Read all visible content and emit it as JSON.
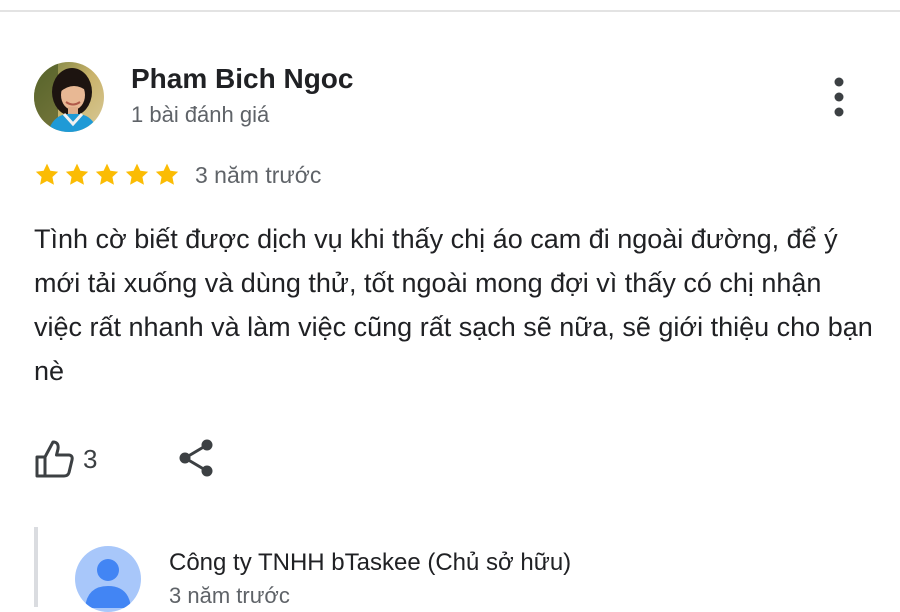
{
  "review": {
    "author": {
      "name": "Pham Bich Ngoc",
      "meta": "1 bài đánh giá"
    },
    "rating": {
      "value": 5,
      "max": 5,
      "star_color": "#fbbc04"
    },
    "time": "3 năm trước",
    "text": "Tình cờ biết được dịch vụ khi thấy chị áo cam đi ngoài đường, để ý mới tải xuống và dùng thử, tốt ngoài mong đợi vì thấy có chị nhận việc rất nhanh và làm việc cũng rất sạch sẽ nữa, sẽ giới thiệu cho bạn nè",
    "likes": "3",
    "icons": {
      "more": "more-vertical-icon",
      "like": "thumbs-up-icon",
      "share": "share-icon"
    }
  },
  "owner_reply": {
    "name": "Công ty TNHH bTaskee (Chủ sở hữu)",
    "time": "3 năm trước",
    "avatar_color": "#a8c7fa",
    "avatar_glyph_color": "#4285f4"
  }
}
